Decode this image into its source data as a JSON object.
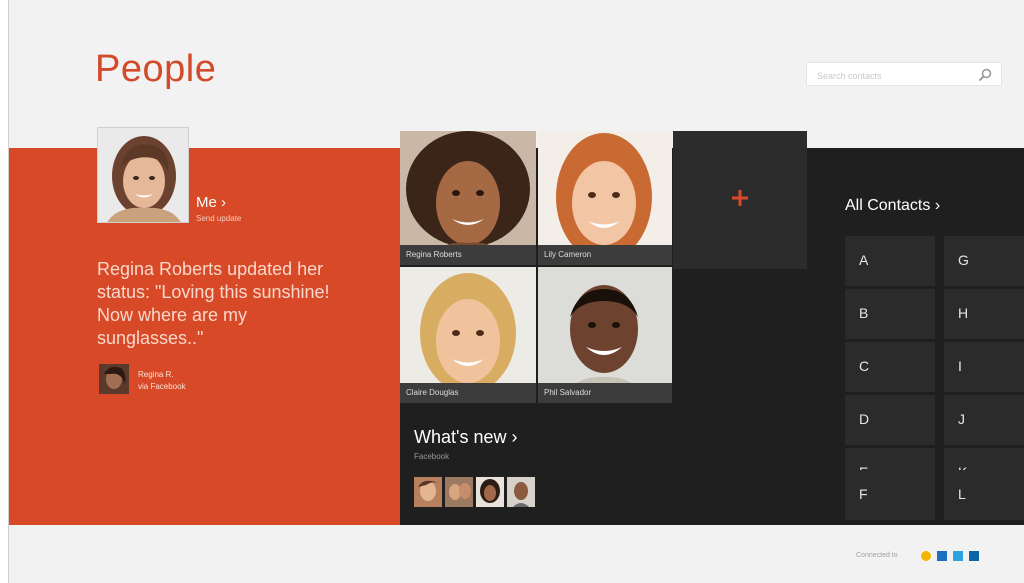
{
  "app": {
    "title": "People"
  },
  "search": {
    "placeholder": "Search contacts",
    "icon": "search-icon"
  },
  "me": {
    "label": "Me ›",
    "sub": "Send update"
  },
  "status": {
    "text": "Regina Roberts updated her status: \"Loving this sunshine! Now where are my sunglasses..\"",
    "name": "Regina R.",
    "source": "via Facebook"
  },
  "favorites": [
    {
      "name": "Regina Roberts"
    },
    {
      "name": "Lily Cameron"
    },
    {
      "name": "Claire Douglas"
    },
    {
      "name": "Phil Salvador"
    }
  ],
  "add_tile": {
    "icon": "plus-icon"
  },
  "whats_new": {
    "label": "What's new ›",
    "sub": "Facebook"
  },
  "all_contacts": {
    "label": "All Contacts ›",
    "letters": [
      "A",
      "G",
      "B",
      "H",
      "C",
      "I",
      "D",
      "J",
      "E",
      "K",
      "F",
      "L"
    ]
  },
  "footer": {
    "label": "Connected to",
    "icons": [
      "messenger-icon",
      "outlook-icon",
      "twitter-icon",
      "linkedin-icon"
    ]
  },
  "colors": {
    "accent": "#d84a27",
    "dark": "#1f1f1f",
    "tile": "#2b2b2b"
  }
}
